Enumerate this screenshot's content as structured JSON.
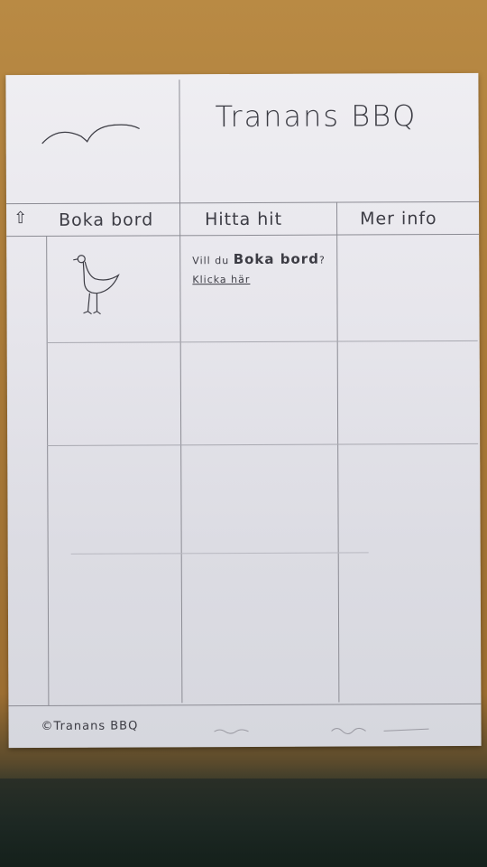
{
  "header": {
    "title": "Tranans BBQ",
    "logo_icon": "bird-wings-icon"
  },
  "nav": {
    "home_icon": "arrow-up-icon",
    "items": [
      {
        "label": "Boka bord"
      },
      {
        "label": "Hitta hit"
      },
      {
        "label": "Mer info"
      }
    ]
  },
  "content": {
    "prompt_prefix": "Vill du",
    "prompt_emphasis": "Boka bord",
    "prompt_suffix": "?",
    "link_label": "Klicka här",
    "image_icon": "crane-bird-icon"
  },
  "footer": {
    "copyright": "©Tranans BBQ"
  },
  "colors": {
    "paper": "#e9e8ee",
    "pencil": "#3c3c44",
    "desk": "#a97a38"
  }
}
